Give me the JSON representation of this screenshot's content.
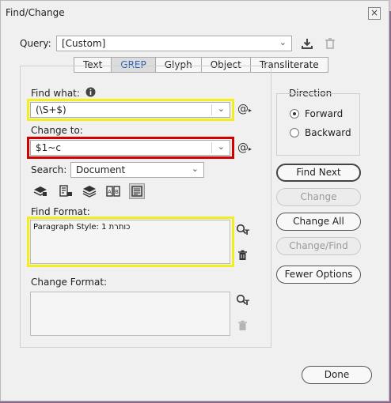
{
  "window": {
    "title": "Find/Change",
    "close_glyph": "×"
  },
  "query": {
    "label": "Query:",
    "value": "[Custom]"
  },
  "tabs": [
    {
      "label": "Text",
      "active": false
    },
    {
      "label": "GREP",
      "active": true
    },
    {
      "label": "Glyph",
      "active": false
    },
    {
      "label": "Object",
      "active": false
    },
    {
      "label": "Transliterate",
      "active": false
    }
  ],
  "find_what": {
    "label": "Find what:",
    "value": "(\\S+$)"
  },
  "change_to": {
    "label": "Change to:",
    "value": "$1~c"
  },
  "search": {
    "label": "Search:",
    "value": "Document"
  },
  "find_format": {
    "label": "Find Format:",
    "value": "Paragraph Style: 1 כותרת"
  },
  "change_format": {
    "label": "Change Format:",
    "value": ""
  },
  "direction": {
    "label": "Direction",
    "options": [
      "Forward",
      "Backward"
    ],
    "selected": "Forward"
  },
  "buttons": {
    "find_next": "Find Next",
    "change": "Change",
    "change_all": "Change All",
    "change_find": "Change/Find",
    "fewer_options": "Fewer Options",
    "done": "Done"
  },
  "colors": {
    "highlight_yellow": "#f3ef1e",
    "highlight_red": "#d40000",
    "active_tab": "#2a5fb8"
  },
  "icons": [
    "close-icon",
    "save-query-icon",
    "delete-query-icon",
    "info-icon",
    "special-characters-icon",
    "include-locked-layers-icon",
    "include-locked-stories-icon",
    "include-hidden-layers-icon",
    "include-master-pages-icon",
    "include-footnotes-icon",
    "specify-format-icon",
    "clear-format-icon"
  ]
}
